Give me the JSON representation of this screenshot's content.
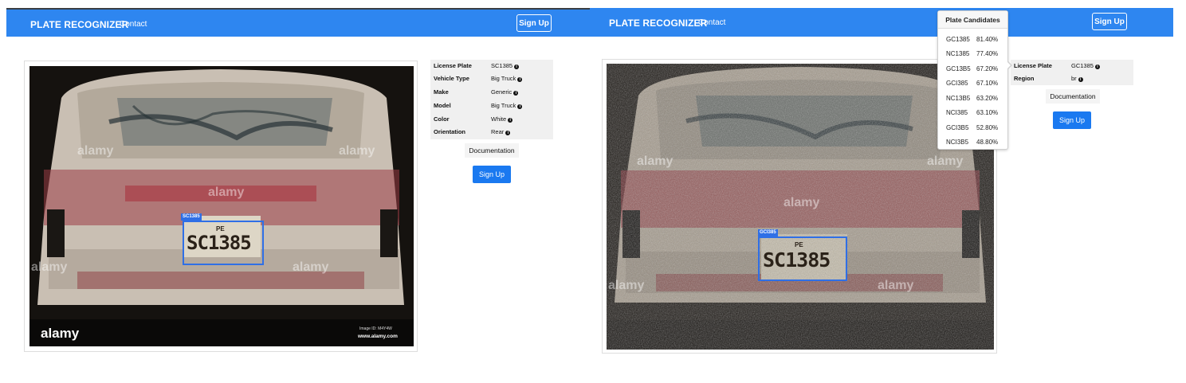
{
  "left": {
    "navbar": {
      "brand": "PLATE RECOGNIZER",
      "contact": "Contact",
      "signup": "Sign Up"
    },
    "image": {
      "plate_tag": "SC1385",
      "plate_region": "PE",
      "plate_number": "SC1385",
      "watermark": "alamy",
      "image_id": "Image ID: M4Y4W",
      "site": "www.alamy.com"
    },
    "details": [
      {
        "key": "License Plate",
        "value": "SC1385"
      },
      {
        "key": "Vehicle Type",
        "value": "Big Truck"
      },
      {
        "key": "Make",
        "value": "Generic"
      },
      {
        "key": "Model",
        "value": "Big Truck"
      },
      {
        "key": "Color",
        "value": "White"
      },
      {
        "key": "Orientation",
        "value": "Rear"
      }
    ],
    "documentation": "Documentation",
    "signup_button": "Sign Up"
  },
  "right": {
    "navbar": {
      "brand": "PLATE RECOGNIZER",
      "contact": "Contact",
      "signup": "Sign Up"
    },
    "image": {
      "plate_tag": "GCI385",
      "plate_region": "PE",
      "plate_number": "SC1385",
      "watermark": "alamy"
    },
    "popover": {
      "title": "Plate Candidates",
      "candidates": [
        {
          "plate": "GC1385",
          "score": "81.40%"
        },
        {
          "plate": "NC1385",
          "score": "77.40%"
        },
        {
          "plate": "GC13B5",
          "score": "67.20%"
        },
        {
          "plate": "GCI385",
          "score": "67.10%"
        },
        {
          "plate": "NC13B5",
          "score": "63.20%"
        },
        {
          "plate": "NCI385",
          "score": "63.10%"
        },
        {
          "plate": "GCI3B5",
          "score": "52.80%"
        },
        {
          "plate": "NCI3B5",
          "score": "48.80%"
        }
      ]
    },
    "details": [
      {
        "key": "License Plate",
        "value": "GC1385"
      },
      {
        "key": "Region",
        "value": "br"
      }
    ],
    "documentation": "Documentation",
    "signup_button": "Sign Up"
  },
  "colors": {
    "navbar": "#2e86f0",
    "plate_box": "#2f6fe6",
    "button": "#1a79f0"
  },
  "icons": {
    "info": "info-circle-icon"
  }
}
